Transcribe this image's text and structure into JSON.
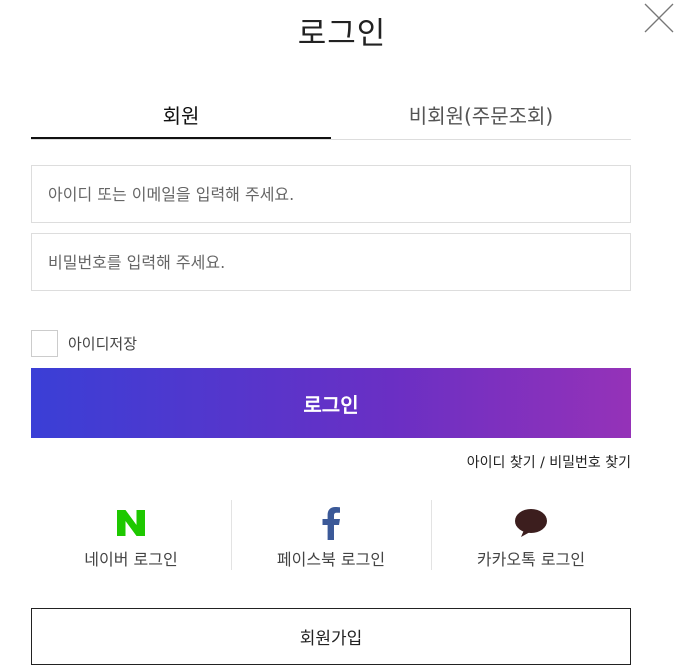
{
  "header": {
    "title": "로그인"
  },
  "tabs": [
    {
      "label": "회원",
      "active": true
    },
    {
      "label": "비회원(주문조회)",
      "active": false
    }
  ],
  "form": {
    "id_placeholder": "아이디 또는 이메일을 입력해 주세요.",
    "password_placeholder": "비밀번호를 입력해 주세요.",
    "remember_label": "아이디저장",
    "login_label": "로그인"
  },
  "find": {
    "find_id": "아이디 찾기",
    "separator": " / ",
    "find_password": "비밀번호 찾기"
  },
  "social": [
    {
      "label": "네이버 로그인",
      "icon": "naver-icon",
      "color": "#1ec800"
    },
    {
      "label": "페이스북 로그인",
      "icon": "facebook-icon",
      "color": "#3b5998"
    },
    {
      "label": "카카오톡 로그인",
      "icon": "kakaotalk-icon",
      "color": "#3c1e1e"
    }
  ],
  "join": {
    "label": "회원가입"
  },
  "colors": {
    "gradient_start": "#3a3fd6",
    "gradient_end": "#9532b8"
  }
}
